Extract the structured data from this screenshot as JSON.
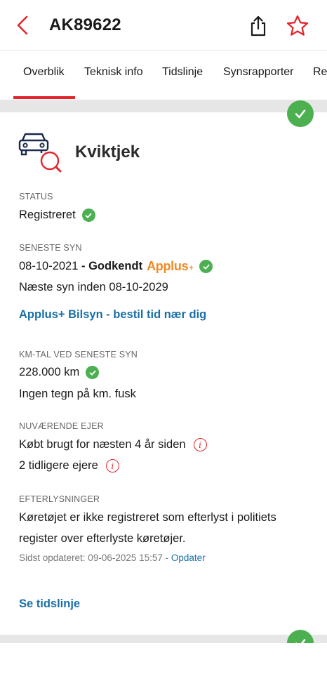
{
  "header": {
    "title": "AK89622",
    "icons": [
      "back-chevron-icon",
      "share-icon",
      "star-icon"
    ],
    "accent_color": "#e3262e"
  },
  "tabs": [
    {
      "label": "Overblik",
      "active": true
    },
    {
      "label": "Teknisk info",
      "active": false
    },
    {
      "label": "Tidslinje",
      "active": false
    },
    {
      "label": "Synsrapporter",
      "active": false
    },
    {
      "label": "Re",
      "active": false
    }
  ],
  "section": {
    "title": "Kviktjek",
    "icon": "car-search-icon",
    "status_color": "#4caf50"
  },
  "status": {
    "label": "STATUS",
    "value": "Registreret"
  },
  "inspection": {
    "label": "SENESTE SYN",
    "date": "08-10-2021",
    "separator": " - ",
    "result": "Godkendt",
    "brand_name": "Applus",
    "brand_plus": "+",
    "next": "Næste syn inden 08-10-2029",
    "link": "Applus+ Bilsyn - bestil tid nær dig"
  },
  "mileage": {
    "label": "KM-TAL VED SENESTE SYN",
    "value": "228.000 km",
    "note": "Ingen tegn på km. fusk"
  },
  "owner": {
    "label": "NUVÆRENDE EJER",
    "bought": "Købt brugt for næsten 4 år siden",
    "previous": "2 tidligere ejere"
  },
  "wanted": {
    "label": "EFTERLYSNINGER",
    "text": "Køretøjet er ikke registreret som efterlyst i politiets register over efterlyste køretøjer.",
    "updated_prefix": "Sidst opdateret: 09-06-2025 15:57 - ",
    "update_link": "Opdater"
  },
  "timeline_link": "Se tidslinje"
}
